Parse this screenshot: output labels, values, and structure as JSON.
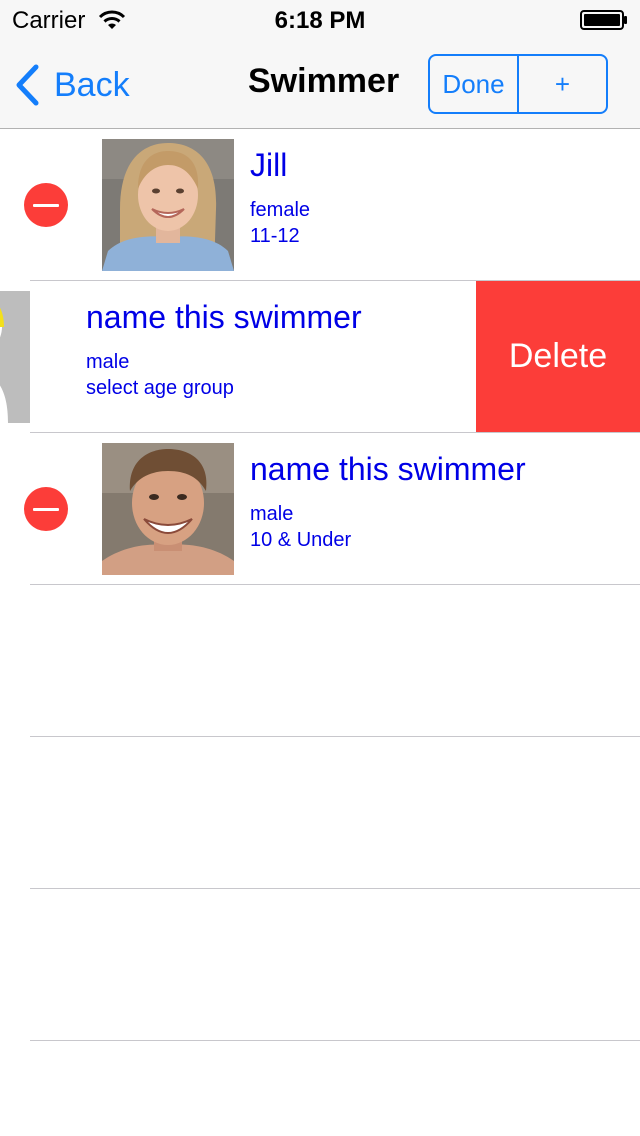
{
  "status_bar": {
    "carrier": "Carrier",
    "time": "6:18 PM"
  },
  "nav": {
    "back_label": "Back",
    "title": "Swimmer",
    "done_label": "Done",
    "add_label": "+"
  },
  "swimmers": [
    {
      "name": "Jill",
      "gender": "female",
      "age_group": "11-12"
    },
    {
      "name": "name this swimmer",
      "gender": "male",
      "age_group": "select age group",
      "delete_label": "Delete"
    },
    {
      "name": "name this swimmer",
      "gender": "male",
      "age_group": "10 & Under"
    }
  ],
  "colors": {
    "tint": "#147efb",
    "delete_red": "#fc3d39",
    "text_blue": "#0000e6",
    "separator": "#c8c7cc",
    "bar_background": "#f7f7f7"
  }
}
